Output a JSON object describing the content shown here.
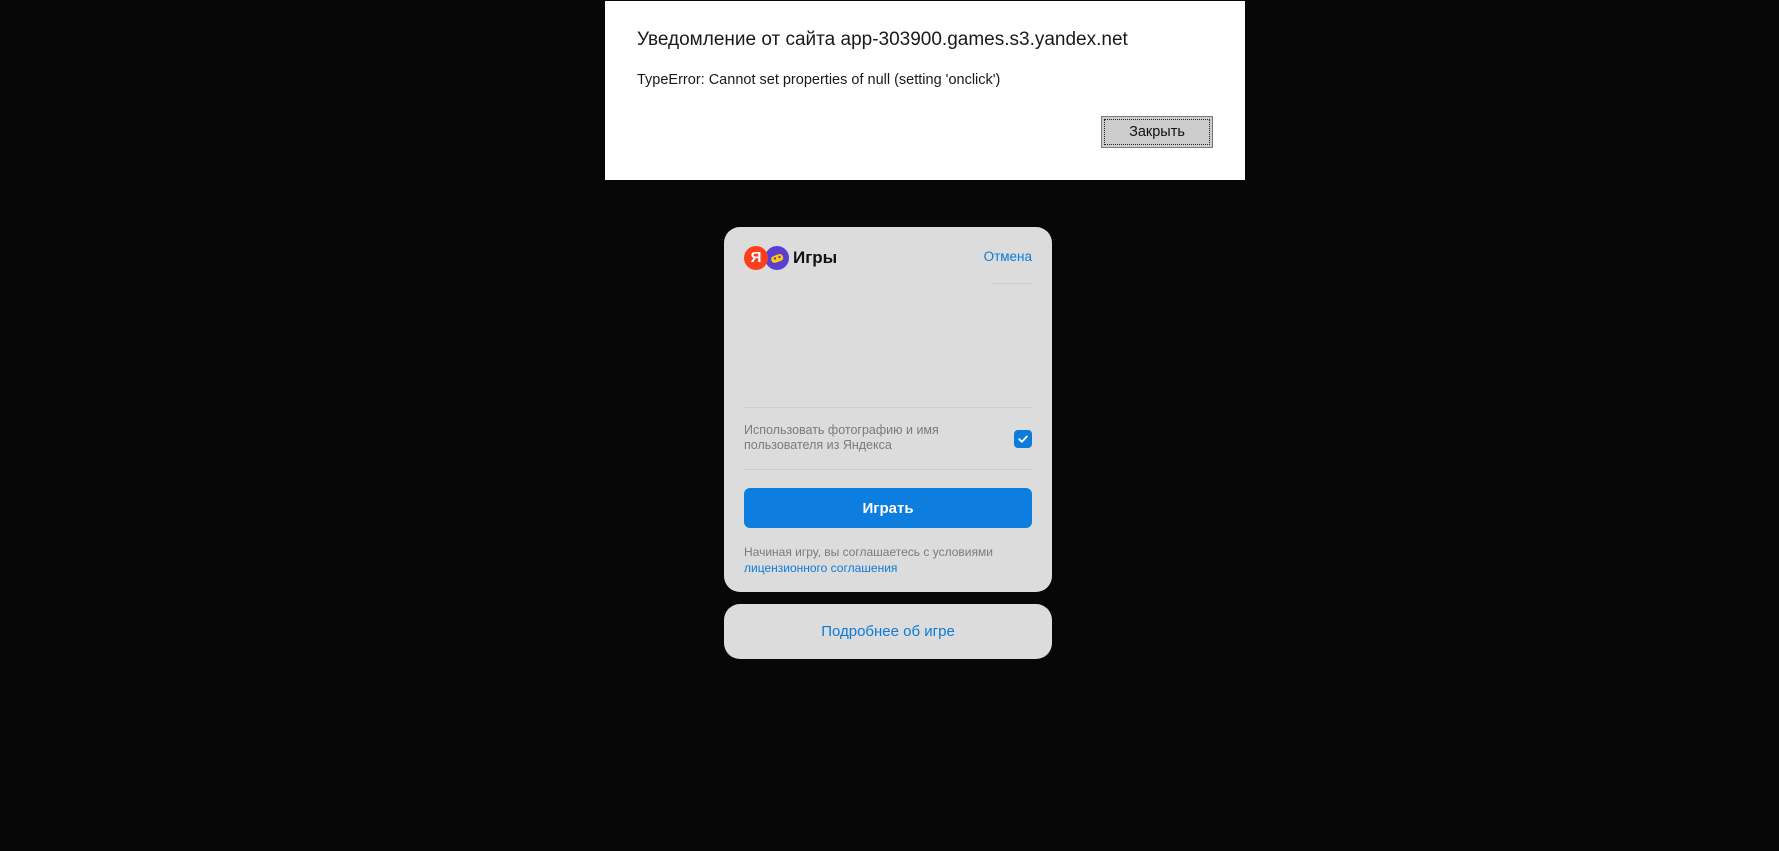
{
  "alert": {
    "title": "Уведомление от сайта app-303900.games.s3.yandex.net",
    "message": "TypeError: Cannot set properties of null (setting 'onclick')",
    "close_label": "Закрыть"
  },
  "login_card": {
    "logo_letter": "Я",
    "brand_name": "Игры",
    "cancel_label": "Отмена",
    "consent_text": "Использовать фотографию и имя пользователя из Яндекса",
    "consent_checked": true,
    "play_label": "Играть",
    "terms_prefix": "Начиная игру, вы соглашаетесь с условиями",
    "terms_link": "лицензионного соглашения",
    "accent_color": "#0d7bd9",
    "icons": [
      "yandex-logo-icon",
      "games-logo-icon",
      "checkmark-icon"
    ]
  },
  "more_card": {
    "label": "Подробнее об игре"
  }
}
